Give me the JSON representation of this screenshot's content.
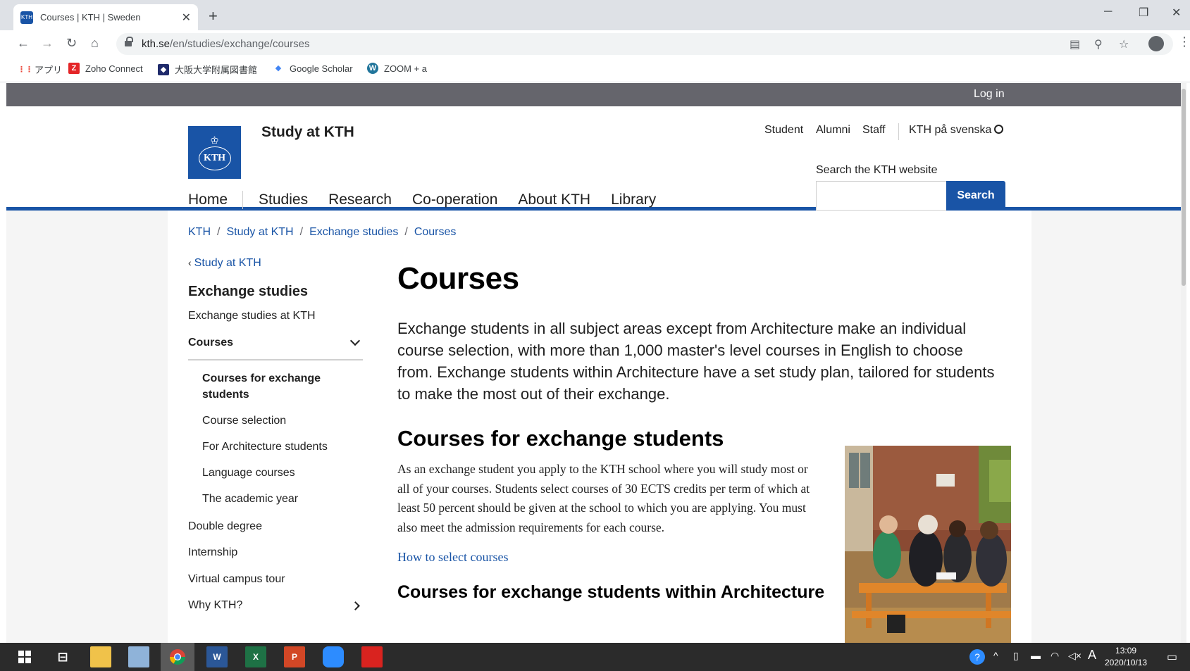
{
  "browser": {
    "tab_title": "Courses | KTH | Sweden",
    "favicon_text": "KTH",
    "close_glyph": "✕",
    "new_tab_glyph": "+",
    "window_minimize": "─",
    "window_restore": "❐",
    "window_close": "✕",
    "url_domain": "kth.se",
    "url_path": "/en/studies/exchange/courses",
    "nav_back": "←",
    "nav_forward": "→",
    "nav_reload": "↻",
    "nav_home": "⌂",
    "bookmarks": [
      {
        "label": "アプリ",
        "icon": "apps-grid-icon",
        "color": "#ea4335",
        "glyph": "⋮⋮"
      },
      {
        "label": "Zoho Connect",
        "icon": "zoho-icon",
        "color": "#e42527",
        "glyph": "Z"
      },
      {
        "label": "大阪大学附属図書館",
        "icon": "osaka-library-icon",
        "color": "#1f2a6b",
        "glyph": "◆"
      },
      {
        "label": "Google Scholar",
        "icon": "scholar-icon",
        "color": "#4285f4",
        "glyph": "◆"
      },
      {
        "label": "ZOOM + a",
        "icon": "wordpress-icon",
        "color": "#21759b",
        "glyph": "W"
      }
    ]
  },
  "site": {
    "login": "Log in",
    "name": "Study at KTH",
    "logo_text": "KTH",
    "top_links": [
      "Student",
      "Alumni",
      "Staff"
    ],
    "language_link": "KTH på svenska",
    "search_label": "Search the KTH website",
    "search_value": "",
    "search_button": "Search",
    "main_nav": [
      "Home",
      "Studies",
      "Research",
      "Co-operation",
      "About KTH",
      "Library"
    ]
  },
  "breadcrumb": [
    "KTH",
    "Study at KTH",
    "Exchange studies",
    "Courses"
  ],
  "sidebar": {
    "back_label": "Study at KTH",
    "heading": "Exchange studies",
    "item_before": "Exchange studies at KTH",
    "active_item": "Courses",
    "sub_items": [
      "Courses for exchange students",
      "Course selection",
      "For Architecture students",
      "Language courses",
      "The academic year"
    ],
    "items_after": [
      "Double degree",
      "Internship",
      "Virtual campus tour"
    ],
    "item_expandable": "Why KTH?"
  },
  "main": {
    "title": "Courses",
    "lead": "Exchange students in all subject areas except from Architecture make an individual course selection, with more than 1,000 master's level courses in English to choose from. Exchange students within Architecture have a set study plan, tailored for students to make the most out of their exchange.",
    "section_heading": "Courses for exchange students",
    "section_body": "As an exchange student you apply to the KTH school where you will study most or all of your courses. Students select courses of 30 ECTS credits per term of which at least 50 percent should be given at the school to which you are applying. You must also meet the admission requirements for each course.",
    "section_link": "How to select courses",
    "next_heading": "Courses for exchange students within Architecture"
  },
  "taskbar": {
    "time": "13:09",
    "date": "2020/10/13",
    "apps": [
      "windows-start-icon",
      "task-view-icon",
      "file-explorer-icon",
      "app-icon",
      "chrome-icon",
      "word-icon",
      "excel-icon",
      "powerpoint-icon",
      "zoom-icon",
      "acrobat-icon"
    ],
    "word_glyph": "W",
    "excel_glyph": "X",
    "ppt_glyph": "P",
    "ime_glyph": "A"
  }
}
